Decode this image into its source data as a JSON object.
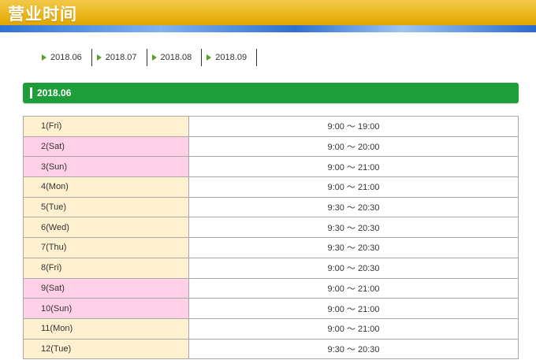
{
  "header": {
    "title": "营业时间"
  },
  "nav": {
    "months": [
      "2018.06",
      "2018.07",
      "2018.08",
      "2018.09"
    ]
  },
  "section": {
    "month_label": "2018.06"
  },
  "colors": {
    "header_gold": "#e9b61a",
    "section_green": "#1e9e3a",
    "weekday_cell": "#fff0d0",
    "weekend_cell": "#ffd0e6",
    "nav_arrow": "#5aa026"
  },
  "schedule": [
    {
      "day": "1(Fri)",
      "hours": "9:00 ～ 19:00",
      "weekend": false
    },
    {
      "day": "2(Sat)",
      "hours": "9:00 ～ 20:00",
      "weekend": true
    },
    {
      "day": "3(Sun)",
      "hours": "9:00 ～ 21:00",
      "weekend": true
    },
    {
      "day": "4(Mon)",
      "hours": "9:00 ～ 21:00",
      "weekend": false
    },
    {
      "day": "5(Tue)",
      "hours": "9:30 ～ 20:30",
      "weekend": false
    },
    {
      "day": "6(Wed)",
      "hours": "9:30 ～ 20:30",
      "weekend": false
    },
    {
      "day": "7(Thu)",
      "hours": "9:30 ～ 20:30",
      "weekend": false
    },
    {
      "day": "8(Fri)",
      "hours": "9:00 ～ 20:30",
      "weekend": false
    },
    {
      "day": "9(Sat)",
      "hours": "9:00 ～ 21:00",
      "weekend": true
    },
    {
      "day": "10(Sun)",
      "hours": "9:00 ～ 21:00",
      "weekend": true
    },
    {
      "day": "11(Mon)",
      "hours": "9:00 ～ 21:00",
      "weekend": false
    },
    {
      "day": "12(Tue)",
      "hours": "9:30 ～ 20:30",
      "weekend": false
    }
  ]
}
